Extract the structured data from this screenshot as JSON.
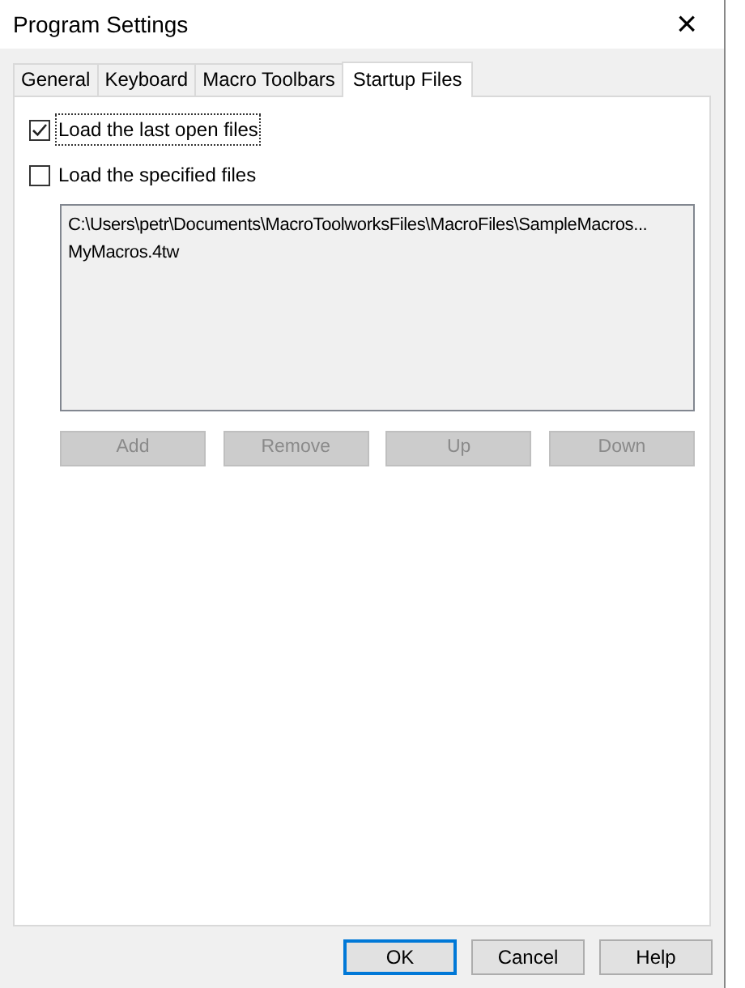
{
  "window": {
    "title": "Program Settings",
    "close": "×"
  },
  "tabs": [
    {
      "label": "General",
      "selected": false
    },
    {
      "label": "Keyboard",
      "selected": false
    },
    {
      "label": "Macro Toolbars",
      "selected": false
    },
    {
      "label": "Startup Files",
      "selected": true
    }
  ],
  "options": [
    {
      "label": "Load the last open files",
      "checked": true,
      "focused": true
    },
    {
      "label": "Load the specified files",
      "checked": false,
      "focused": false
    }
  ],
  "file_list": [
    "C:\\Users\\petr\\Documents\\MacroToolworksFiles\\MacroFiles\\SampleMacros...",
    "MyMacros.4tw"
  ],
  "list_buttons": [
    {
      "label": "Add",
      "disabled": true
    },
    {
      "label": "Remove",
      "disabled": true
    },
    {
      "label": "Up",
      "disabled": true
    },
    {
      "label": "Down",
      "disabled": true
    }
  ],
  "dialog_buttons": [
    {
      "label": "OK",
      "default": true
    },
    {
      "label": "Cancel",
      "default": false
    },
    {
      "label": "Help",
      "default": false
    }
  ]
}
